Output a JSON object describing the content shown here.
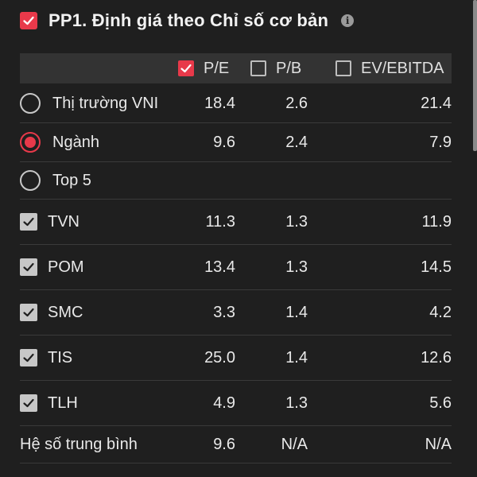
{
  "title": "PP1. Định giá theo Chỉ số cơ bản",
  "header": {
    "pe": {
      "label": "P/E",
      "checked": true
    },
    "pb": {
      "label": "P/B",
      "checked": false
    },
    "ev": {
      "label": "EV/EBITDA",
      "checked": false
    }
  },
  "markets": [
    {
      "label": "Thị trường VNI",
      "selected": false,
      "pe": "18.4",
      "pb": "2.6",
      "ev": "21.4"
    },
    {
      "label": "Ngành",
      "selected": true,
      "pe": "9.6",
      "pb": "2.4",
      "ev": "7.9"
    },
    {
      "label": "Top 5",
      "selected": false,
      "pe": "",
      "pb": "",
      "ev": ""
    }
  ],
  "stocks": [
    {
      "label": "TVN",
      "pe": "11.3",
      "pb": "1.3",
      "ev": "11.9"
    },
    {
      "label": "POM",
      "pe": "13.4",
      "pb": "1.3",
      "ev": "14.5"
    },
    {
      "label": "SMC",
      "pe": "3.3",
      "pb": "1.4",
      "ev": "4.2"
    },
    {
      "label": "TIS",
      "pe": "25.0",
      "pb": "1.4",
      "ev": "12.6"
    },
    {
      "label": "TLH",
      "pe": "4.9",
      "pb": "1.3",
      "ev": "5.6"
    }
  ],
  "average": {
    "label": "Hệ số trung bình",
    "pe": "9.6",
    "pb": "N/A",
    "ev": "N/A"
  },
  "colors": {
    "accent": "#e8394a",
    "background": "#1f1f1f",
    "header_bg": "#333333"
  }
}
